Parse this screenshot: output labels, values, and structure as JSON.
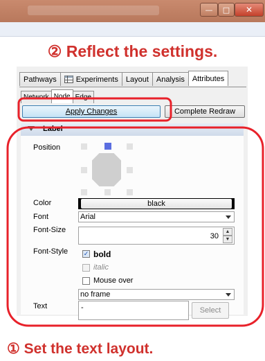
{
  "window": {
    "controls": {
      "minimize": "—",
      "maximize": "□",
      "close": "✕"
    }
  },
  "annotations": {
    "top": "② Reflect the settings.",
    "bottom": "① Set the text layout.",
    "highlight_color": "#e8212a"
  },
  "tabs": [
    "Pathways",
    "Experiments",
    "Layout",
    "Analysis",
    "Attributes"
  ],
  "active_tab": "Attributes",
  "subtabs": [
    "Network",
    "Node",
    "Edge"
  ],
  "active_subtab": "Node",
  "buttons": {
    "apply": "Apply Changes",
    "redraw": "Complete Redraw"
  },
  "section": {
    "title": "Label"
  },
  "fields": {
    "position_label": "Position",
    "color_label": "Color",
    "color_value": "black",
    "font_label": "Font",
    "font_value": "Arial",
    "font_size_label": "Font-Size",
    "font_size_value": "30",
    "font_style_label": "Font-Style",
    "bold_label": "bold",
    "bold_checked": true,
    "italic_label": "italic",
    "italic_checked": false,
    "mouse_over_label": "Mouse over",
    "mouse_over_checked": false,
    "frame_value": "no frame",
    "text_label": "Text",
    "text_value": "-",
    "select_button": "Select"
  },
  "icons": {
    "experiments_tab": "table-icon",
    "position_selected": "top-center"
  }
}
